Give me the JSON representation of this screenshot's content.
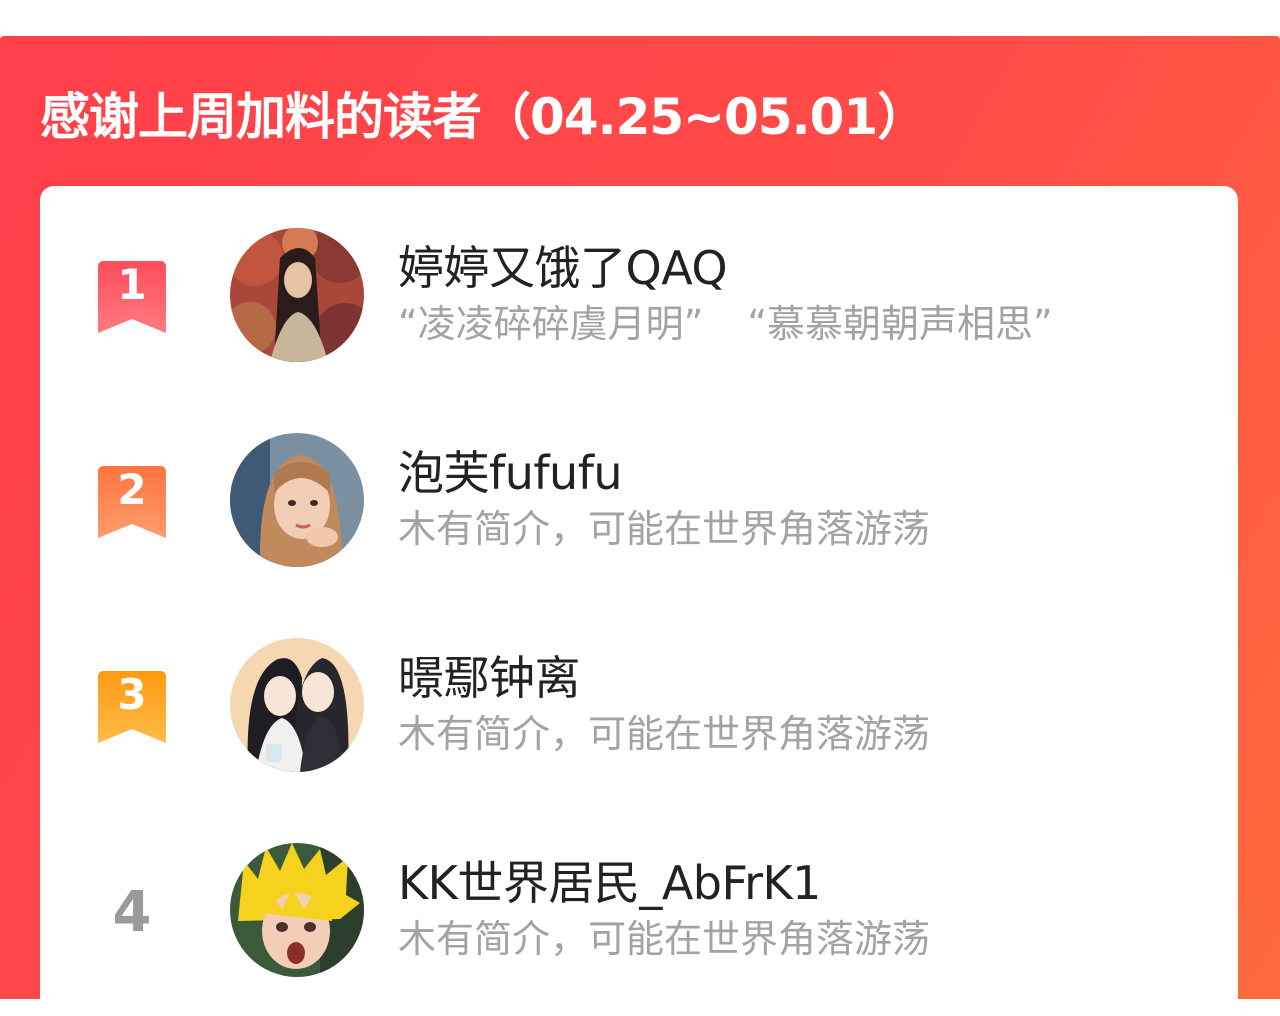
{
  "header": {
    "title": "感谢上周加料的读者（04.25~05.01）"
  },
  "colors": {
    "panel_red": "#ff4a48",
    "rank_1": "#ff5463",
    "rank_2": "#ff7d4a",
    "rank_3": "#ff9f1f",
    "rank_other": "#9a9a9a",
    "name_text": "#222222",
    "desc_text": "#a3a3a3"
  },
  "readers": [
    {
      "rank": "1",
      "name": "婷婷又饿了QAQ",
      "tags": [
        "“凌凌碎碎虞月明”",
        "“慕慕朝朝声相思”"
      ],
      "avatar_icon": "avatar-girl-autumn-leaves"
    },
    {
      "rank": "2",
      "name": "泡芙fufufu",
      "bio": "木有简介，可能在世界角落游荡",
      "avatar_icon": "avatar-girl-portrait"
    },
    {
      "rank": "3",
      "name": "暻鄢钟离",
      "bio": "木有简介，可能在世界角落游荡",
      "avatar_icon": "avatar-anime-couple"
    },
    {
      "rank": "4",
      "name": "KK世界居民_AbFrK1",
      "bio": "木有简介，可能在世界角落游荡",
      "avatar_icon": "avatar-yellow-hair-face"
    }
  ]
}
